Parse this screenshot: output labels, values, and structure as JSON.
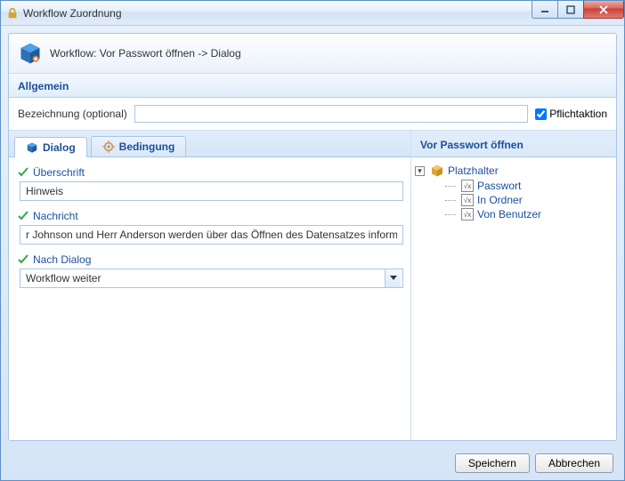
{
  "window": {
    "title": "Workflow Zuordnung"
  },
  "header": {
    "workflow_label": "Workflow: Vor Passwort öffnen -> Dialog"
  },
  "section_allgemein": {
    "title": "Allgemein",
    "bezeichnung_label": "Bezeichnung (optional)",
    "bezeichnung_value": "",
    "pflicht_label": "Pflichtaktion",
    "pflicht_checked": true
  },
  "tabs": {
    "dialog": "Dialog",
    "bedingung": "Bedingung"
  },
  "dialog_form": {
    "ueberschrift_label": "Überschrift",
    "ueberschrift_value": "Hinweis",
    "nachricht_label": "Nachricht",
    "nachricht_value": "r Johnson und Herr Anderson werden über das Öffnen des Datensatzes informier",
    "nach_dialog_label": "Nach Dialog",
    "nach_dialog_value": "Workflow weiter"
  },
  "platzhalter_panel": {
    "title": "Vor Passwort öffnen",
    "root": "Platzhalter",
    "items": [
      "Passwort",
      "In Ordner",
      "Von Benutzer"
    ]
  },
  "footer": {
    "save": "Speichern",
    "cancel": "Abbrechen"
  }
}
